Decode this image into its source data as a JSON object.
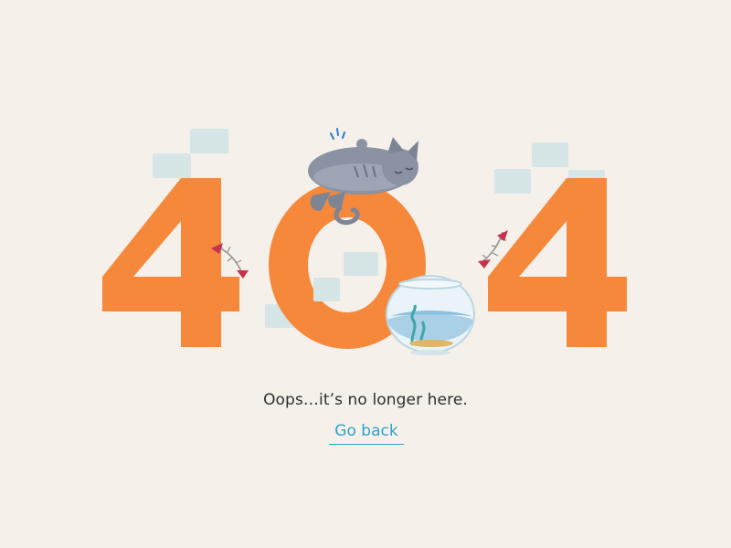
{
  "error": {
    "code_digits": [
      "4",
      "0",
      "4"
    ],
    "message": "Oops…it’s no longer here.",
    "back_link_label": "Go back"
  },
  "colors": {
    "background": "#f5f0e9",
    "digit_orange": "#f5883a",
    "tile_blue": "#d6e6e7",
    "cat_gray": "#7d8595",
    "link_blue": "#2ba3cc",
    "text_dark": "#2e2e2e"
  },
  "illustration": {
    "icons": [
      "cat-icon",
      "fishbone-icon",
      "fishbowl-icon"
    ]
  }
}
